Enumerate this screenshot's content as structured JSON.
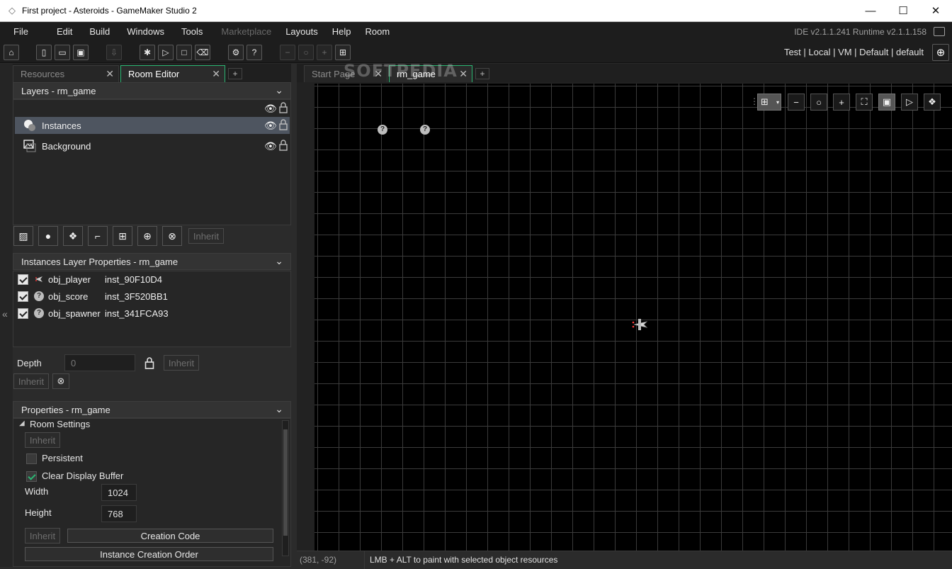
{
  "window": {
    "title": "First project - Asteroids - GameMaker Studio 2",
    "minimize": "—",
    "maximize": "☐",
    "close": "✕"
  },
  "menu": {
    "items": [
      "File",
      "Edit",
      "Build",
      "Windows",
      "Tools",
      "Marketplace",
      "Layouts",
      "Help",
      "Room"
    ],
    "disabled": [
      "Marketplace"
    ],
    "version": "IDE v2.1.1.241 Runtime v2.1.1.158"
  },
  "toolbar": {
    "target": "Test  |  Local  |  VM  |  Default  |  default"
  },
  "left_tabs": {
    "resources": "Resources",
    "room_editor": "Room Editor",
    "add": "+"
  },
  "layers": {
    "header": "Layers - rm_game",
    "items": [
      {
        "name": "Instances",
        "icon": "instances-layer-icon",
        "selected": true
      },
      {
        "name": "Background",
        "icon": "background-layer-icon",
        "selected": false
      }
    ],
    "inherit": "Inherit"
  },
  "instances_layer": {
    "header": "Instances Layer Properties - rm_game",
    "rows": [
      {
        "object": "obj_player",
        "instance": "inst_90F10D4",
        "icon": "ship-sprite-icon"
      },
      {
        "object": "obj_score",
        "instance": "inst_3F520BB1",
        "icon": "question-mark-icon"
      },
      {
        "object": "obj_spawner",
        "instance": "inst_341FCA93",
        "icon": "question-mark-icon"
      }
    ],
    "depth_label": "Depth",
    "depth_value": "0",
    "inherit": "Inherit"
  },
  "properties": {
    "header": "Properties - rm_game",
    "room_settings": "Room Settings",
    "inherit": "Inherit",
    "persistent": "Persistent",
    "clear_display_buffer": "Clear Display Buffer",
    "width_label": "Width",
    "width_value": "1024",
    "height_label": "Height",
    "height_value": "768",
    "creation_code": "Creation Code",
    "instance_creation_order": "Instance Creation Order"
  },
  "room_tabs": {
    "start_page": "Start Page",
    "rm_game": "rm_game",
    "add": "+"
  },
  "status": {
    "coords": "(381, -92)",
    "hint": "LMB + ALT to paint with selected object resources"
  },
  "watermark": "SOFTPEDIA",
  "colors": {
    "accent": "#2bb673",
    "selection": "#4e5560",
    "canvas": "#000000"
  }
}
